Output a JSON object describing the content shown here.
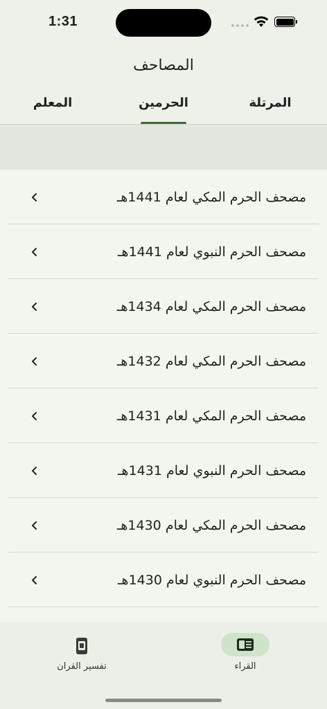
{
  "status_bar": {
    "time": "1:31"
  },
  "header": {
    "title": "المصاحف",
    "tabs": [
      {
        "label": "المرتلة"
      },
      {
        "label": "الحرمين"
      },
      {
        "label": "المعلم"
      }
    ],
    "selected_tab": "الحرمين"
  },
  "list": {
    "items": [
      {
        "label": "مصحف الحرم المكي لعام 1441هـ"
      },
      {
        "label": "مصحف الحرم النبوي لعام 1441هـ"
      },
      {
        "label": "مصحف الحرم المكي لعام 1434هـ"
      },
      {
        "label": "مصحف الحرم المكي لعام 1432هـ"
      },
      {
        "label": "مصحف الحرم المكي لعام 1431هـ"
      },
      {
        "label": "مصحف الحرم النبوي لعام 1431هـ"
      },
      {
        "label": "مصحف الحرم المكي لعام 1430هـ"
      },
      {
        "label": "مصحف الحرم النبوي لعام 1430هـ"
      }
    ]
  },
  "bottom_nav": {
    "items": [
      {
        "label": "القراء",
        "icon": "reader-icon"
      },
      {
        "label": "تفسير القران",
        "icon": "tafsir-icon"
      }
    ]
  },
  "colors": {
    "accent": "#3e6b3c",
    "pill": "#cfe3cb",
    "background": "#f3f6ee"
  }
}
